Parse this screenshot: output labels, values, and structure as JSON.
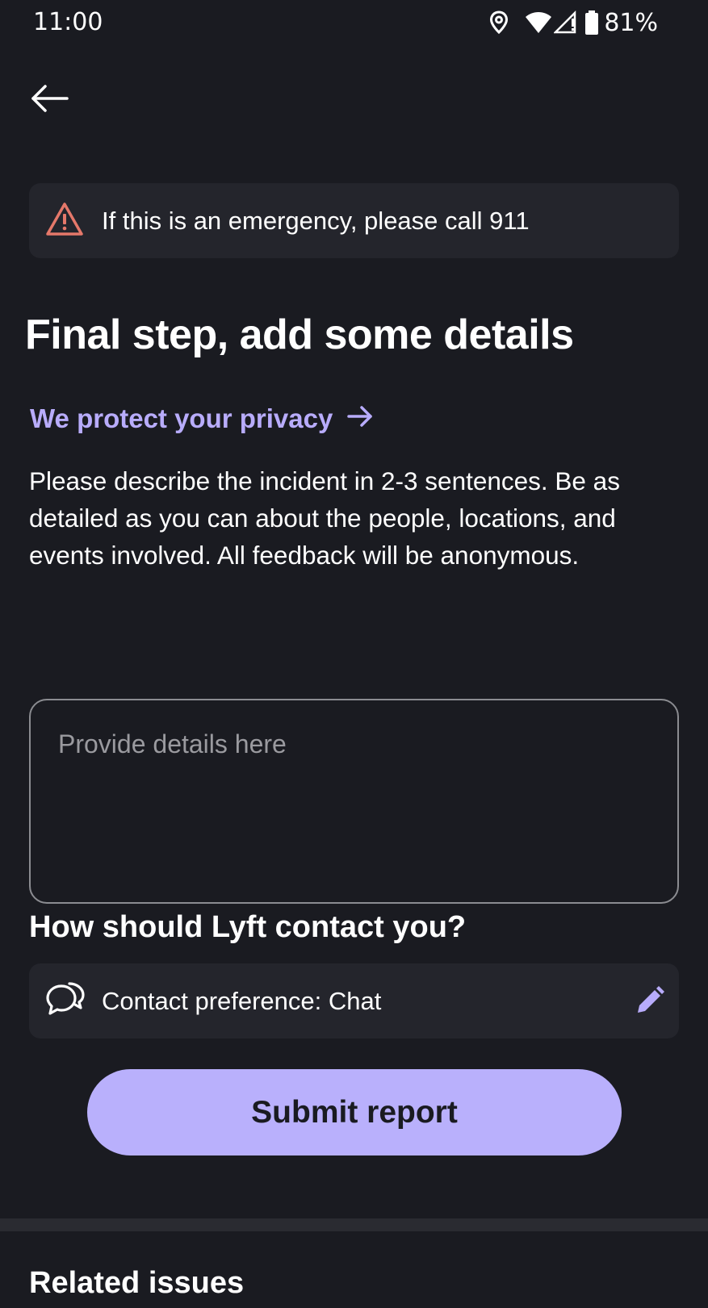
{
  "status_bar": {
    "time": "11:00",
    "battery": "81%",
    "icons": [
      "location-icon",
      "wifi-icon",
      "signal-icon",
      "battery-icon"
    ]
  },
  "header": {
    "back_icon": "back-arrow-icon"
  },
  "emergency": {
    "icon": "warning-triangle-icon",
    "text": "If this is an emergency, please call 911",
    "icon_color": "#e5786a"
  },
  "main": {
    "title": "Final step, add some details",
    "privacy_link": "We protect your privacy",
    "description": "Please describe the incident in 2-3 sentences. Be as detailed as you can about the people, locations, and events involved. All feedback will be anonymous.",
    "details_input": {
      "placeholder": "Provide details here",
      "value": ""
    }
  },
  "contact": {
    "heading": "How should Lyft contact you?",
    "icon": "chat-bubbles-icon",
    "preference_text": "Contact preference: Chat",
    "edit_icon": "pencil-icon"
  },
  "submit": {
    "label": "Submit report"
  },
  "related": {
    "heading": "Related issues"
  },
  "colors": {
    "background": "#1a1b21",
    "card": "#24252c",
    "accent": "#b8acfb",
    "button": "#b9b0fc",
    "warning": "#e5786a"
  }
}
